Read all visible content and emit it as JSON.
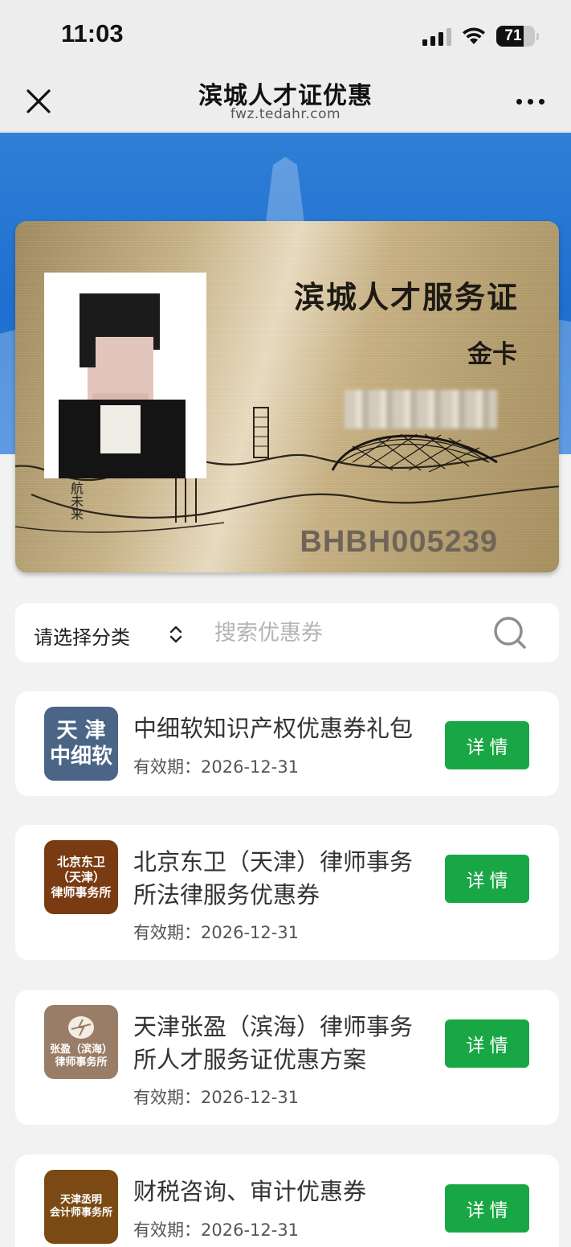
{
  "status_bar": {
    "time": "11:03",
    "battery": "71",
    "battery_level": 0.71
  },
  "nav": {
    "title": "滨城人才证优惠",
    "subtitle": "fwz.tedahr.com"
  },
  "card": {
    "title": "滨城人才服务证",
    "level": "金卡",
    "number": "BHBH005239",
    "signature": "航未来"
  },
  "search": {
    "category_label": "请选择分类",
    "placeholder": "搜索优惠券"
  },
  "coupons": [
    {
      "logo_lines": [
        "天 津",
        "中细软"
      ],
      "logo_color": "#4b6586",
      "title": "中细软知识产权优惠券礼包",
      "expiry": "有效期：2026-12-31",
      "button": "详情"
    },
    {
      "logo_lines": [
        "北京东卫",
        "（天津）",
        "律师事务所"
      ],
      "logo_color": "#7a3a12",
      "title": "北京东卫（天津）律师事务所法律服务优惠券",
      "expiry": "有效期：2026-12-31",
      "button": "详情"
    },
    {
      "logo_lines": [
        "张盈（滨海）",
        "律师事务所"
      ],
      "logo_color": "#9a7d66",
      "title": "天津张盈（滨海）律师事务所人才服务证优惠方案",
      "expiry": "有效期：2026-12-31",
      "button": "详情"
    },
    {
      "logo_lines": [
        "天津丞明",
        "会计师事务所"
      ],
      "logo_color": "#7b4a14",
      "title": "财税咨询、审计优惠券",
      "expiry": "有效期：2026-12-31",
      "button": "详情"
    }
  ]
}
